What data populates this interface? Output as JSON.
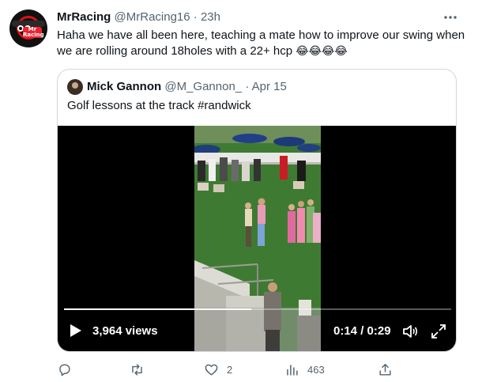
{
  "tweet": {
    "author_name": "MrRacing",
    "author_handle": "@MrRacing16",
    "separator": "·",
    "time": "23h",
    "more_icon": "more-horizontal-icon",
    "text": "Haha we have all been here, teaching a mate how to improve our swing when we are rolling around 18holes with a 22+ hcp",
    "emojis": [
      "😂",
      "😂",
      "😂",
      "😂"
    ],
    "avatar_badge": "Mr Racing"
  },
  "quote": {
    "author_name": "Mick Gannon",
    "author_handle": "@M_Gannon_",
    "separator": "·",
    "time": "Apr 15",
    "text": "Golf lessons at the track #randwick",
    "video": {
      "views": "3,964 views",
      "timecode": "0:14 / 0:29",
      "progress": 0.483
    }
  },
  "actions": {
    "reply": {
      "icon": "reply-icon",
      "count": ""
    },
    "retweet": {
      "icon": "retweet-icon",
      "count": ""
    },
    "like": {
      "icon": "heart-icon",
      "count": "2"
    },
    "views": {
      "icon": "analytics-icon",
      "count": "463"
    },
    "share": {
      "icon": "share-icon",
      "count": ""
    }
  },
  "colors": {
    "text_primary": "#0f1419",
    "text_secondary": "#536471",
    "border": "#cfd9de",
    "video_bg": "#000000",
    "grass": "#3f7a33"
  }
}
